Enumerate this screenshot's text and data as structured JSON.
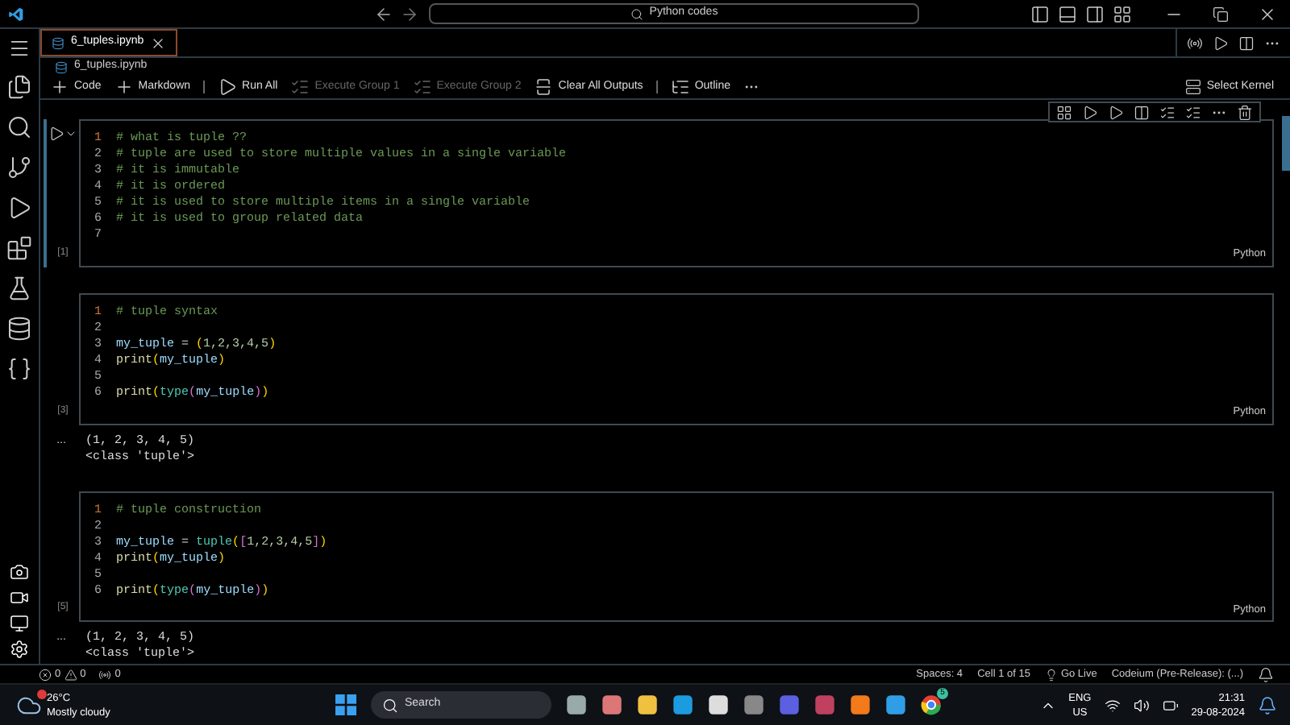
{
  "window": {
    "search": "Python codes"
  },
  "tabs": [
    {
      "label": "6_tuples.ipynb",
      "selected": true
    }
  ],
  "breadcrumb": "6_tuples.ipynb",
  "toolbar": [
    {
      "label": "Code",
      "kind": "add",
      "disabled": false
    },
    {
      "label": "Markdown",
      "kind": "add",
      "disabled": false
    },
    {
      "label": "Run All",
      "kind": "run",
      "disabled": false
    },
    {
      "label": "Execute Group 1",
      "kind": "group",
      "disabled": true
    },
    {
      "label": "Execute Group 2",
      "kind": "group",
      "disabled": true
    },
    {
      "label": "Clear All Outputs",
      "kind": "clear",
      "disabled": false
    },
    {
      "label": "Outline",
      "kind": "outline",
      "disabled": false
    }
  ],
  "kernel": "Select Kernel",
  "cells": [
    {
      "count": "[1]",
      "selected": true,
      "lines": [
        {
          "number": "1",
          "current": true,
          "tokens": [
            {
              "text": "# what is tuple ??",
              "kind": "comment"
            }
          ]
        },
        {
          "number": "2",
          "current": false,
          "tokens": [
            {
              "text": "# tuple are used to store multiple values in a single variable",
              "kind": "comment"
            }
          ]
        },
        {
          "number": "3",
          "current": false,
          "tokens": [
            {
              "text": "# it is immutable",
              "kind": "comment"
            }
          ]
        },
        {
          "number": "4",
          "current": false,
          "tokens": [
            {
              "text": "# it is ordered",
              "kind": "comment"
            }
          ]
        },
        {
          "number": "5",
          "current": false,
          "tokens": [
            {
              "text": "# it is used to store multiple items in a single variable",
              "kind": "comment"
            }
          ]
        },
        {
          "number": "6",
          "current": false,
          "tokens": [
            {
              "text": "# it is used to group related data",
              "kind": "comment"
            }
          ]
        },
        {
          "number": "7",
          "current": false
        }
      ],
      "language": "Python"
    },
    {
      "count": "[3]",
      "selected": false,
      "lines": [
        {
          "number": "1",
          "current": true,
          "tokens": [
            {
              "text": "# tuple syntax",
              "kind": "comment"
            }
          ]
        },
        {
          "number": "2",
          "current": false
        },
        {
          "number": "3",
          "current": false,
          "tokens": [
            {
              "text": "my_tuple",
              "kind": "var"
            },
            {
              "text": " = ",
              "kind": "op"
            },
            {
              "text": "(",
              "kind": "paren"
            },
            {
              "text": "1,2,3,4,5",
              "kind": "num"
            },
            {
              "text": ")",
              "kind": "paren"
            }
          ]
        },
        {
          "number": "4",
          "current": false,
          "tokens": [
            {
              "text": "print",
              "kind": "func"
            },
            {
              "text": "(",
              "kind": "paren"
            },
            {
              "text": "my_tuple",
              "kind": "var"
            },
            {
              "text": ")",
              "kind": "paren"
            }
          ]
        },
        {
          "number": "5",
          "current": false
        },
        {
          "number": "6",
          "current": false,
          "tokens": [
            {
              "text": "print",
              "kind": "func"
            },
            {
              "text": "(",
              "kind": "paren"
            },
            {
              "text": "type",
              "kind": "builtin"
            },
            {
              "text": "(",
              "kind": "paren2"
            },
            {
              "text": "my_tuple",
              "kind": "var"
            },
            {
              "text": ")",
              "kind": "paren2"
            },
            {
              "text": ")",
              "kind": "paren"
            }
          ]
        }
      ],
      "language": "Python",
      "output": {
        "marker": "...",
        "lines": [
          "(1, 2, 3, 4, 5)",
          "<class 'tuple'>"
        ]
      }
    },
    {
      "count": "[5]",
      "selected": false,
      "lines": [
        {
          "number": "1",
          "current": true,
          "tokens": [
            {
              "text": "# tuple construction",
              "kind": "comment"
            }
          ]
        },
        {
          "number": "2",
          "current": false
        },
        {
          "number": "3",
          "current": false,
          "tokens": [
            {
              "text": "my_tuple",
              "kind": "var"
            },
            {
              "text": " = ",
              "kind": "op"
            },
            {
              "text": "tuple",
              "kind": "builtin"
            },
            {
              "text": "(",
              "kind": "paren"
            },
            {
              "text": "[",
              "kind": "paren2"
            },
            {
              "text": "1,2,3,4,5",
              "kind": "num"
            },
            {
              "text": "]",
              "kind": "paren2"
            },
            {
              "text": ")",
              "kind": "paren"
            }
          ]
        },
        {
          "number": "4",
          "current": false,
          "tokens": [
            {
              "text": "print",
              "kind": "func"
            },
            {
              "text": "(",
              "kind": "paren"
            },
            {
              "text": "my_tuple",
              "kind": "var"
            },
            {
              "text": ")",
              "kind": "paren"
            }
          ]
        },
        {
          "number": "5",
          "current": false
        },
        {
          "number": "6",
          "current": false,
          "tokens": [
            {
              "text": "print",
              "kind": "func"
            },
            {
              "text": "(",
              "kind": "paren"
            },
            {
              "text": "type",
              "kind": "builtin"
            },
            {
              "text": "(",
              "kind": "paren2"
            },
            {
              "text": "my_tuple",
              "kind": "var"
            },
            {
              "text": ")",
              "kind": "paren2"
            },
            {
              "text": ")",
              "kind": "paren"
            }
          ]
        }
      ],
      "language": "Python",
      "output": {
        "marker": "...",
        "lines": [
          "(1, 2, 3, 4, 5)",
          "<class 'tuple'>"
        ]
      }
    }
  ],
  "status_bar": {
    "errors": "0",
    "warnings": "0",
    "ports": "0",
    "right": [
      "Spaces: 4",
      "Cell 1 of 15",
      "Go Live",
      "Codeium (Pre-Release): (...)"
    ]
  },
  "taskbar": {
    "temperature": "26°C",
    "weather": "Mostly cloudy",
    "search": "Search",
    "chrome_badge": "5",
    "lang": "ENG",
    "region": "US",
    "time": "21:31",
    "date": "29-08-2024"
  }
}
